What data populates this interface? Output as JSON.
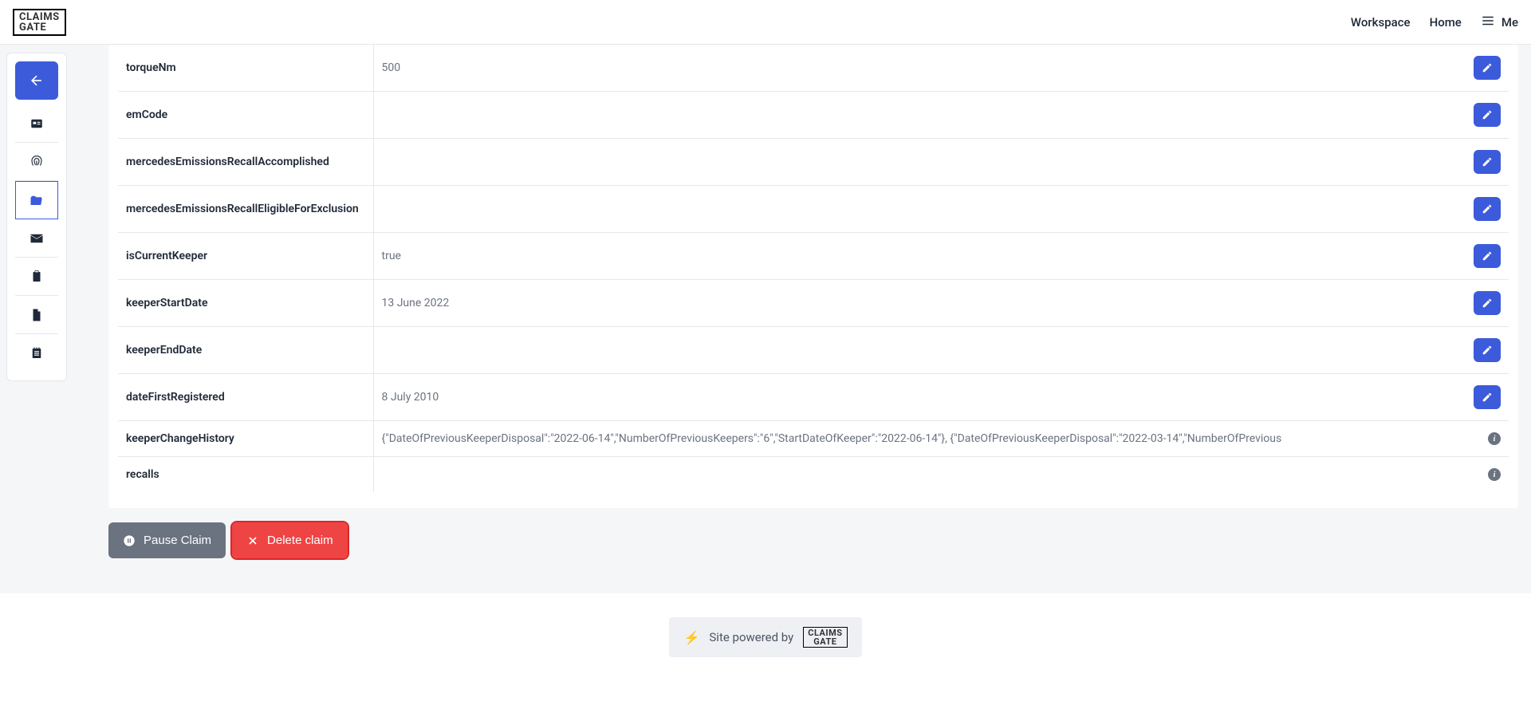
{
  "brand": {
    "line1": "CLAIMS",
    "line2": "GATE"
  },
  "nav": {
    "workspace": "Workspace",
    "home": "Home",
    "me": "Me"
  },
  "rows": [
    {
      "key": "torqueNm",
      "value": "500",
      "editable": true
    },
    {
      "key": "emCode",
      "value": "",
      "editable": true
    },
    {
      "key": "mercedesEmissionsRecallAccomplished",
      "value": "",
      "editable": true
    },
    {
      "key": "mercedesEmissionsRecallEligibleForExclusion",
      "value": "",
      "editable": true
    },
    {
      "key": "isCurrentKeeper",
      "value": "true",
      "editable": true
    },
    {
      "key": "keeperStartDate",
      "value": "13 June 2022",
      "editable": true
    },
    {
      "key": "keeperEndDate",
      "value": "",
      "editable": true
    },
    {
      "key": "dateFirstRegistered",
      "value": "8 July 2010",
      "editable": true
    },
    {
      "key": "keeperChangeHistory",
      "value": "{\"DateOfPreviousKeeperDisposal\":\"2022-06-14\",\"NumberOfPreviousKeepers\":\"6\",\"StartDateOfKeeper\":\"2022-06-14\"}, {\"DateOfPreviousKeeperDisposal\":\"2022-03-14\",\"NumberOfPrevious",
      "editable": false
    },
    {
      "key": "recalls",
      "value": "",
      "editable": false
    }
  ],
  "actions": {
    "pause": "Pause Claim",
    "delete": "Delete claim"
  },
  "footer": {
    "powered": "Site powered by"
  }
}
